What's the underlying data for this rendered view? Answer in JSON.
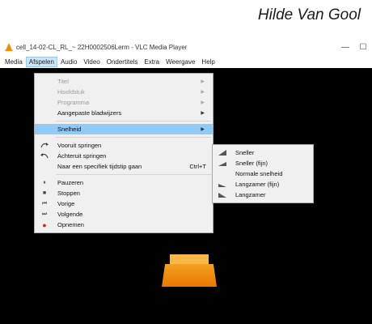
{
  "author": "Hilde Van Gool",
  "window": {
    "title": "cell_14-02-CL_RL_~ 22H0002506Lerm - VLC Media Player",
    "minimize_glyph": "—",
    "maximize_glyph": "☐"
  },
  "menubar": [
    "Media",
    "Afspelen",
    "Audio",
    "Video",
    "Ondertitels",
    "Extra",
    "Weergave",
    "Help"
  ],
  "afspelen_menu": {
    "top_items": [
      {
        "label": "Titel",
        "disabled": true,
        "submenu": true
      },
      {
        "label": "Hoofdstuk",
        "disabled": true,
        "submenu": true
      },
      {
        "label": "Programma",
        "disabled": true,
        "submenu": true
      },
      {
        "label": "Aangepaste bladwijzers",
        "disabled": false,
        "submenu": true
      }
    ],
    "speed": {
      "label": "Snelheid",
      "submenu": true
    },
    "jump_items": [
      {
        "label": "Vooruit springen",
        "icon": "jump-forward-icon"
      },
      {
        "label": "Achteruit springen",
        "icon": "jump-backward-icon"
      },
      {
        "label": "Naar een specifiek tijdstip gaan",
        "shortcut": "Ctrl+T"
      }
    ],
    "control_items": [
      {
        "label": "Pauzeren",
        "icon": "pause-icon",
        "glyph": "⏸"
      },
      {
        "label": "Stoppen",
        "icon": "stop-icon",
        "glyph": "■"
      },
      {
        "label": "Vorige",
        "icon": "previous-icon",
        "glyph": "⏮"
      },
      {
        "label": "Volgende",
        "icon": "next-icon",
        "glyph": "⏭"
      },
      {
        "label": "Opnemen",
        "icon": "record-icon",
        "glyph": "●",
        "color": "#e02020"
      }
    ]
  },
  "speed_menu": {
    "items": [
      {
        "label": "Sneller",
        "icon": "faster-icon"
      },
      {
        "label": "Sneller (fijn)",
        "icon": "faster-fine-icon"
      },
      {
        "label": "Normale snelheid",
        "icon": ""
      },
      {
        "label": "Langzamer (fijn)",
        "icon": "slower-fine-icon"
      },
      {
        "label": "Langzamer",
        "icon": "slower-icon"
      }
    ]
  },
  "colors": {
    "highlight": "#91c9f7",
    "video_bg": "#000000",
    "vlc_orange": "#f08a00"
  }
}
